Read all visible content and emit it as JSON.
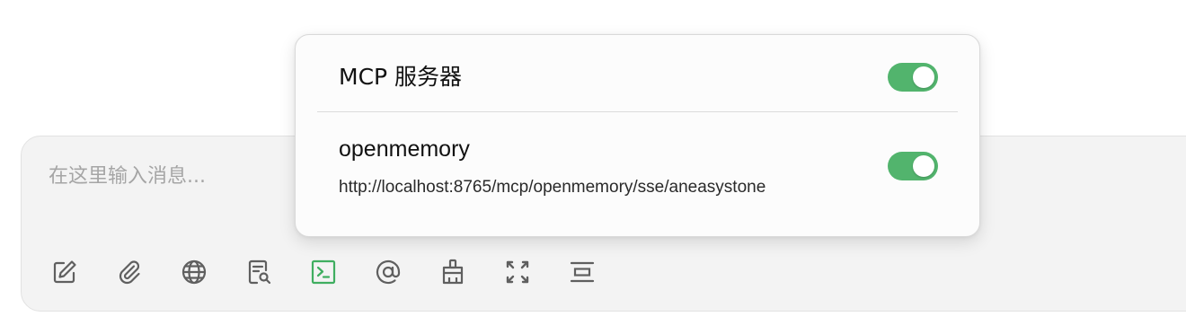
{
  "chat_input": {
    "placeholder": "在这里输入消息..."
  },
  "toolbar": {
    "buttons": [
      {
        "name": "edit-icon",
        "active": false
      },
      {
        "name": "paperclip-icon",
        "active": false
      },
      {
        "name": "globe-icon",
        "active": false
      },
      {
        "name": "document-search-icon",
        "active": false
      },
      {
        "name": "terminal-icon",
        "active": true
      },
      {
        "name": "at-icon",
        "active": false
      },
      {
        "name": "broom-icon",
        "active": false
      },
      {
        "name": "expand-icon",
        "active": false
      },
      {
        "name": "divider-icon",
        "active": false
      }
    ],
    "active_color": "#3fae60",
    "icon_color": "#5f5f5f"
  },
  "mcp_popover": {
    "title": "MCP 服务器",
    "enabled": true,
    "toggle_color": "#52b46d",
    "servers": [
      {
        "name": "openmemory",
        "url": "http://localhost:8765/mcp/openmemory/sse/aneasystone",
        "enabled": true
      }
    ]
  }
}
